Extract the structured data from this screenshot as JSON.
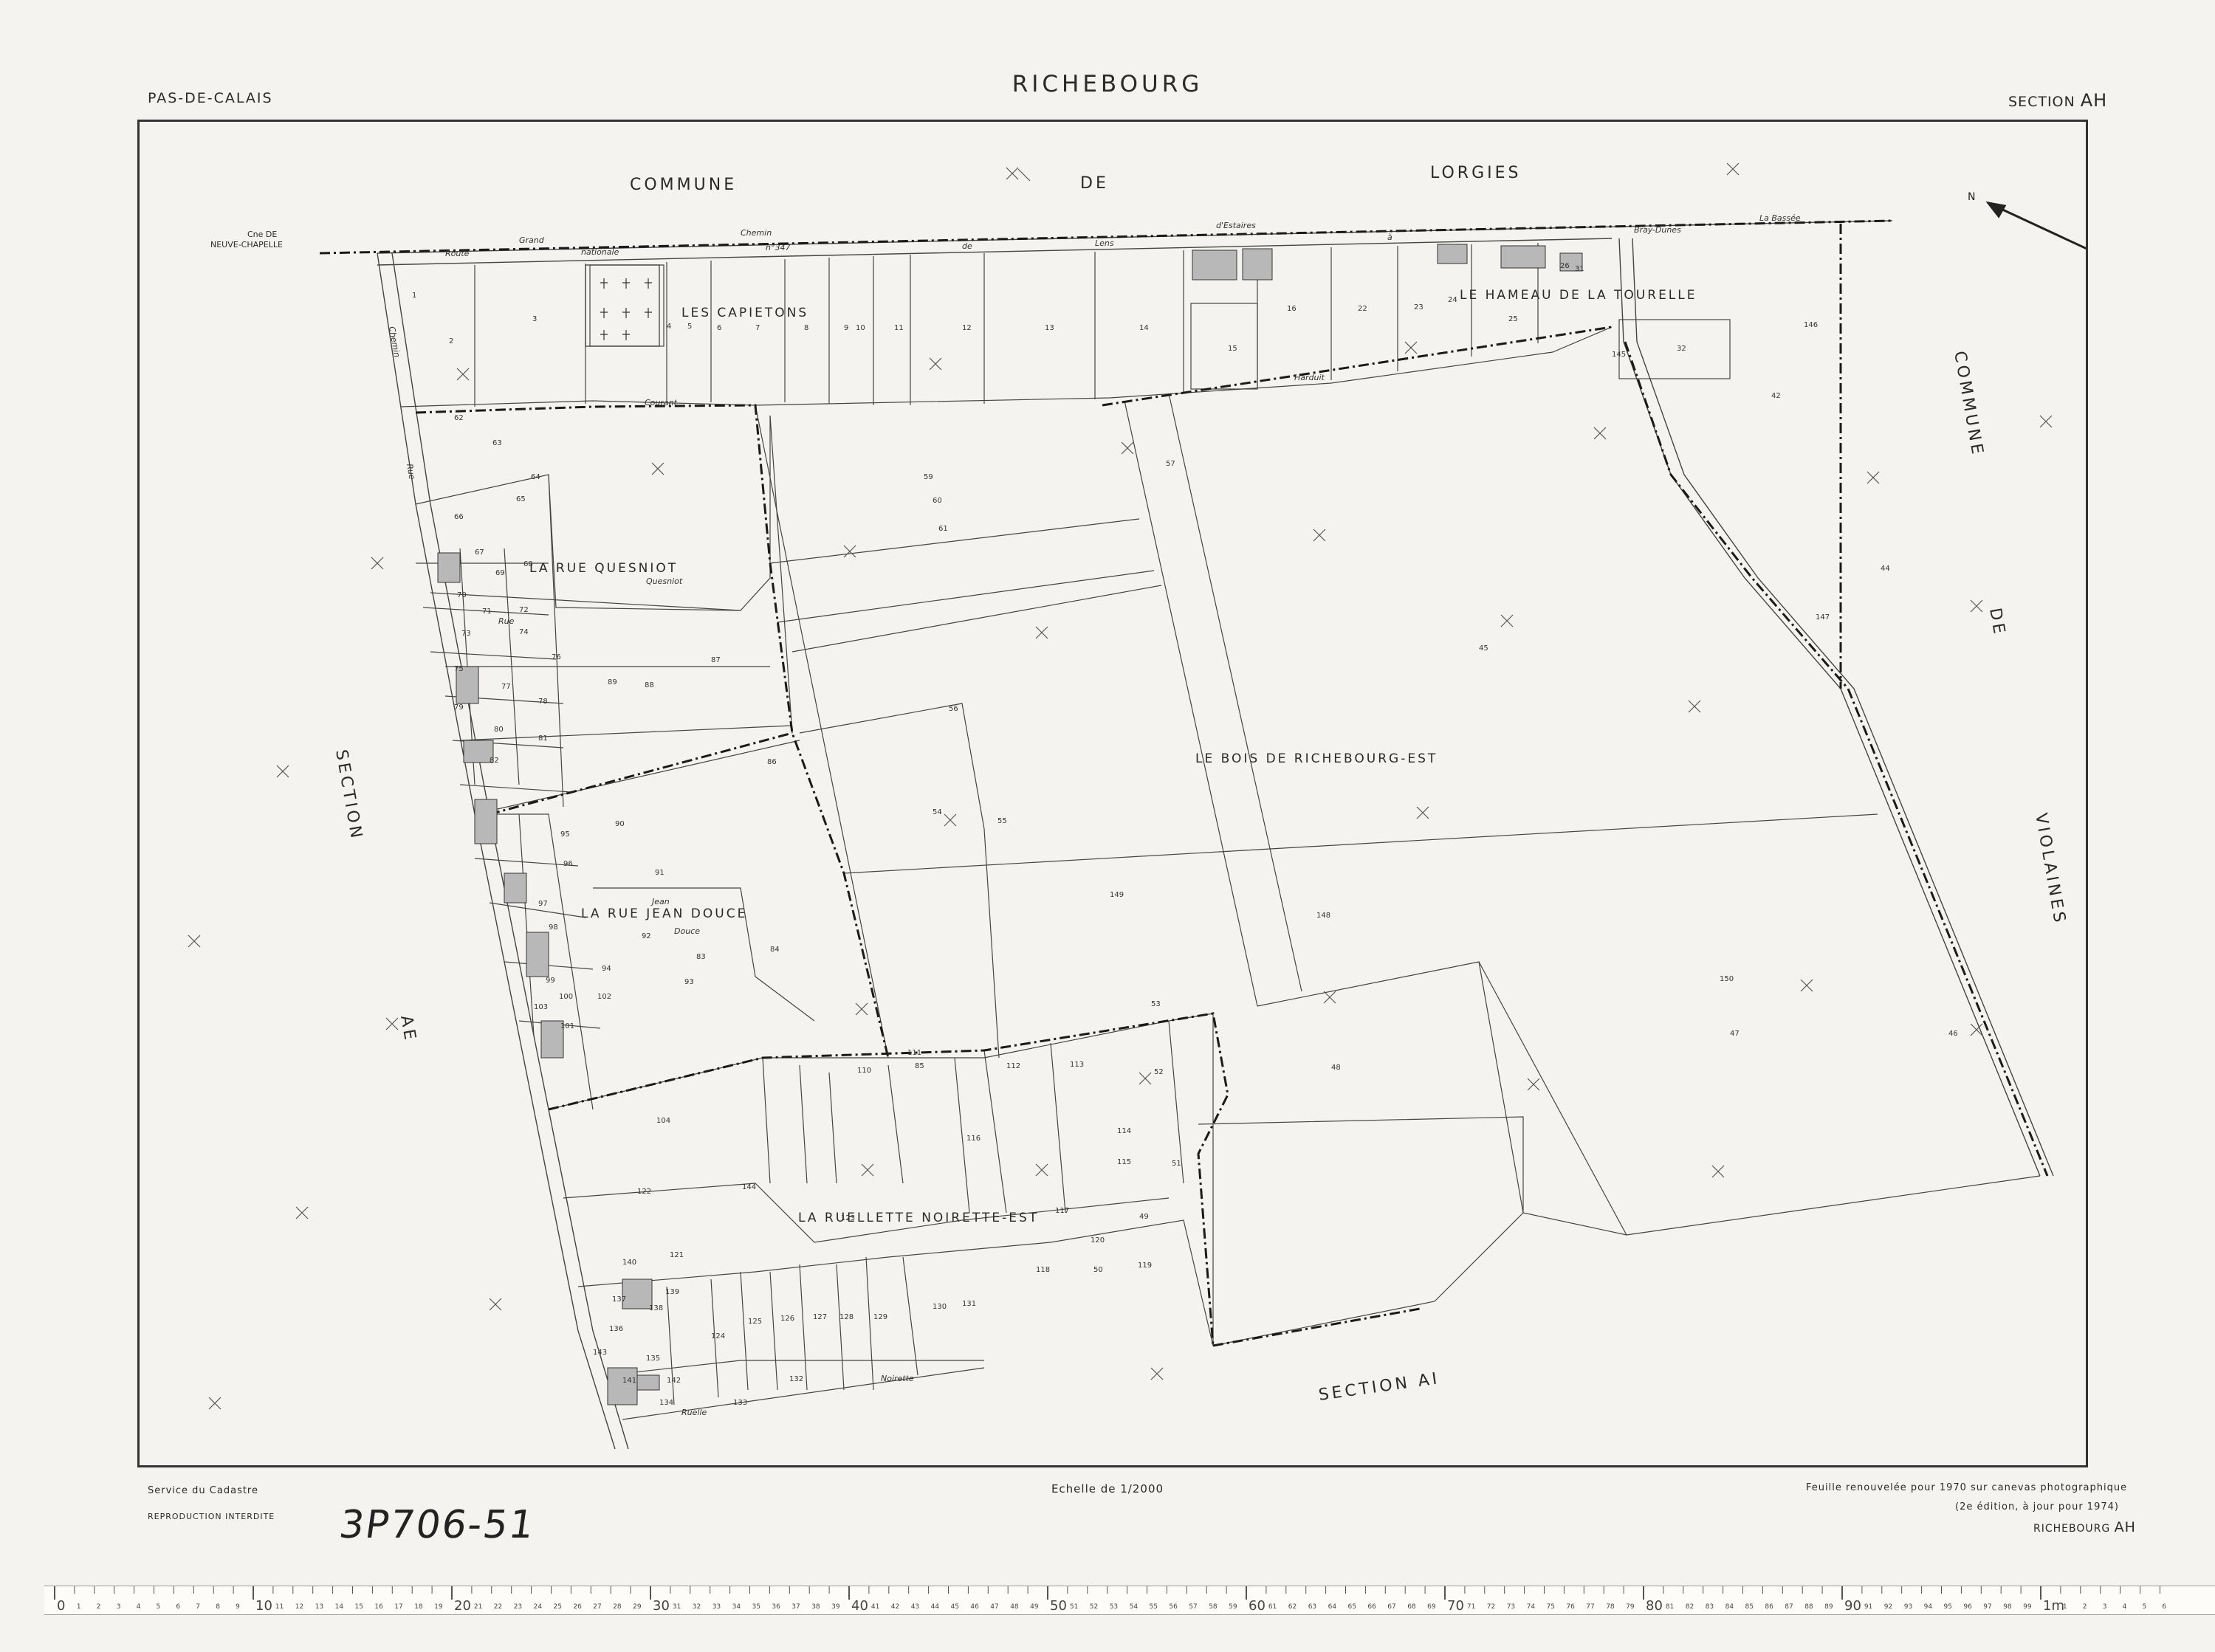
{
  "header": {
    "department": "PAS-DE-CALAIS",
    "title": "RICHEBOURG",
    "section_label": "SECTION",
    "section_code": "AH"
  },
  "map_labels": {
    "commune_north_1": "COMMUNE",
    "commune_north_2": "DE",
    "commune_north_3": "LORGIES",
    "commune_east_1": "COMMUNE",
    "commune_east_2": "DE",
    "commune_east_3": "VIOLAINES",
    "section_west_1": "SECTION",
    "section_west_2": "AE",
    "section_south": "SECTION  AI",
    "neuve_chapelle_1": "Cne DE",
    "neuve_chapelle_2": "NEUVE-CHAPELLE",
    "locality_capietons": "LES CAPIETONS",
    "locality_tourelle": "LE HAMEAU DE LA TOURELLE",
    "locality_quesniot": "LA RUE QUESNIOT",
    "locality_bois": "LE BOIS DE RICHEBOURG-EST",
    "locality_jean_douce": "LA RUE JEAN DOUCE",
    "locality_noirette": "LA RUELLETTE NOIRETTE-EST"
  },
  "road_labels": {
    "route_1": "Route",
    "route_2": "Grand",
    "route_3": "nationale",
    "route_4": "Chemin",
    "route_5": "n°347",
    "route_6": "de",
    "route_7": "Lens",
    "route_8": "d'Estaires",
    "route_9": "à",
    "route_10": "Bray-Dunes",
    "route_11": "La Bassée",
    "courant": "Courant",
    "harduit": "Harduit",
    "quesniot": "Quesniot",
    "rue": "Rue",
    "chemin_west": "Chemin",
    "rue_west": "Rue",
    "noirette": "Noirette",
    "ruelle": "Ruelle",
    "jean": "Jean",
    "douce": "Douce"
  },
  "parcels": [
    "1",
    "2",
    "3",
    "4",
    "5",
    "6",
    "7",
    "8",
    "9",
    "10",
    "11",
    "12",
    "13",
    "14",
    "15",
    "16",
    "22",
    "23",
    "24",
    "25",
    "26",
    "31",
    "32",
    "42",
    "44",
    "45",
    "46",
    "47",
    "48",
    "49",
    "50",
    "51",
    "52",
    "53",
    "54",
    "55",
    "56",
    "57",
    "59",
    "60",
    "61",
    "62",
    "63",
    "64",
    "65",
    "66",
    "67",
    "68",
    "69",
    "70",
    "71",
    "72",
    "73",
    "74",
    "75",
    "76",
    "77",
    "78",
    "79",
    "80",
    "81",
    "82",
    "83",
    "84",
    "85",
    "86",
    "87",
    "88",
    "89",
    "90",
    "91",
    "92",
    "93",
    "94",
    "95",
    "96",
    "97",
    "98",
    "99",
    "100",
    "101",
    "102",
    "103",
    "104",
    "110",
    "111",
    "112",
    "113",
    "114",
    "115",
    "116",
    "117",
    "118",
    "119",
    "120",
    "121",
    "122",
    "123",
    "124",
    "125",
    "126",
    "127",
    "128",
    "129",
    "130",
    "131",
    "132",
    "133",
    "134",
    "135",
    "136",
    "137",
    "138",
    "139",
    "140",
    "141",
    "142",
    "143",
    "144",
    "145",
    "146",
    "147",
    "148",
    "149",
    "150"
  ],
  "footer": {
    "service": "Service du Cadastre",
    "reproduction": "REPRODUCTION  INTERDITE",
    "scale": "Echelle de 1/2000",
    "note_1": "Feuille renouvelée pour 1970 sur canevas photographique",
    "note_2": "(2e édition, à jour pour 1974)",
    "foot_name": "RICHEBOURG",
    "foot_code": "AH"
  },
  "archive_ref": "3P706-51",
  "ruler": {
    "unit_label": "1m",
    "major_labels": [
      "0",
      "10",
      "20",
      "30",
      "40",
      "50",
      "60",
      "70",
      "80",
      "90"
    ]
  },
  "colors": {
    "paper": "#f4f3ef",
    "ink": "#2a2a2a",
    "boundary": "#1a1a1a"
  }
}
